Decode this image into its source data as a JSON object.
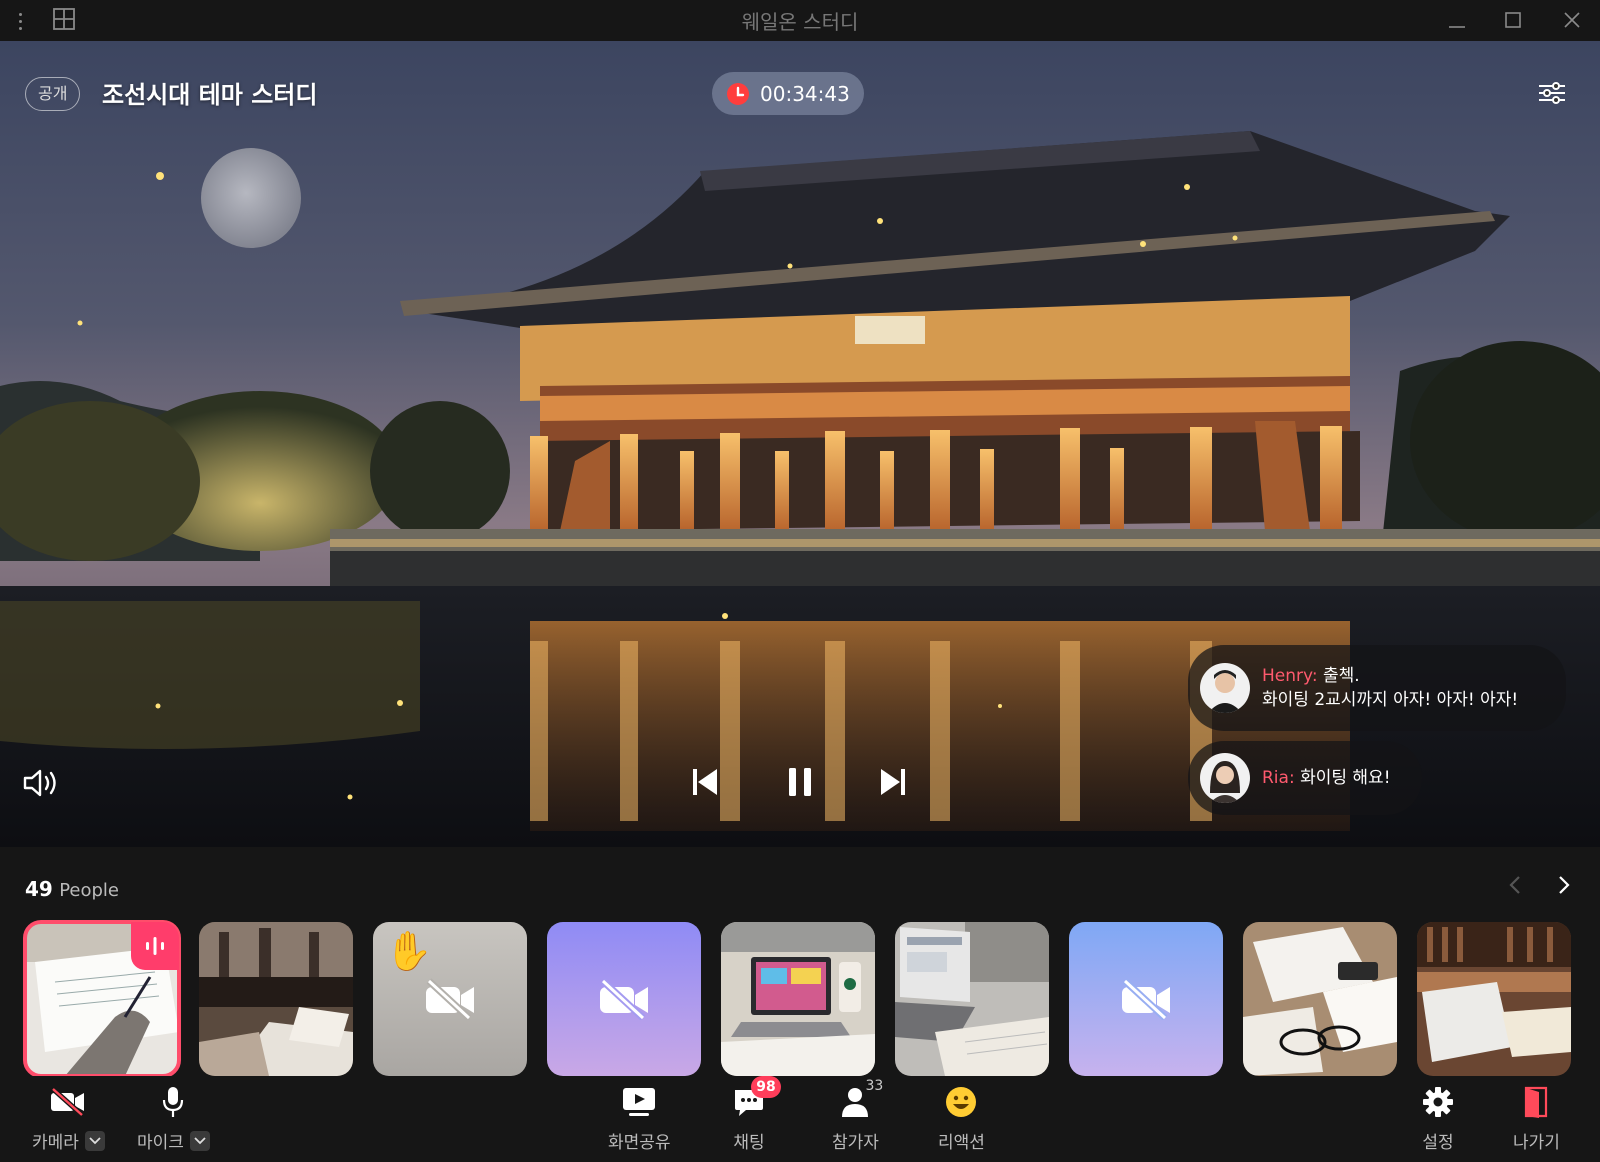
{
  "window": {
    "title": "웨일온 스터디"
  },
  "room": {
    "privacy_label": "공개",
    "title": "조선시대 테마 스터디",
    "timer": "00:34:43"
  },
  "chat": [
    {
      "name": "Henry:",
      "lines": [
        "출첵.",
        "화이팅 2교시까지 아자! 아자! 아자!"
      ]
    },
    {
      "name": "Ria:",
      "lines": [
        "화이팅 해요!"
      ]
    }
  ],
  "people": {
    "count": "49",
    "label": "People",
    "tiles": [
      {
        "kind": "photo-writing",
        "speaking": true
      },
      {
        "kind": "photo-books-rail"
      },
      {
        "kind": "camera-off",
        "color_top": "#c8c5c0",
        "color_bottom": "#a9a6a2",
        "raised_hand": "✋"
      },
      {
        "kind": "camera-off",
        "color_top": "#8f8bf5",
        "color_bottom": "#c9a8e6"
      },
      {
        "kind": "photo-laptop-coffee"
      },
      {
        "kind": "photo-laptop-desk"
      },
      {
        "kind": "camera-off",
        "color_top": "#7fa8f5",
        "color_bottom": "#c7b2ee"
      },
      {
        "kind": "photo-notes-glasses"
      },
      {
        "kind": "photo-library"
      }
    ]
  },
  "toolbar": {
    "camera_label": "카메라",
    "mic_label": "마이크",
    "screenshare_label": "화면공유",
    "chat_label": "채팅",
    "chat_badge": "98",
    "participants_label": "참가자",
    "participants_count": "33",
    "reaction_label": "리액션",
    "settings_label": "설정",
    "leave_label": "나가기"
  },
  "colors": {
    "accent": "#ff3d5a",
    "speaking": "#ff3d6b",
    "name_highlight": "#ff5a6e",
    "background": "#161616"
  },
  "icons": {
    "menu": "vertical-dots-icon",
    "layout": "grid-layout-icon",
    "timer": "clock-icon",
    "filters": "sliders-icon",
    "volume": "speaker-icon",
    "prev": "skip-previous-icon",
    "pause": "pause-icon",
    "next": "skip-next-icon",
    "camera_off": "camera-off-icon",
    "mic": "microphone-icon",
    "screenshare": "screen-share-icon",
    "chat": "chat-icon",
    "participants": "person-icon",
    "reaction": "smile-icon",
    "settings": "gear-icon",
    "leave": "exit-door-icon"
  }
}
